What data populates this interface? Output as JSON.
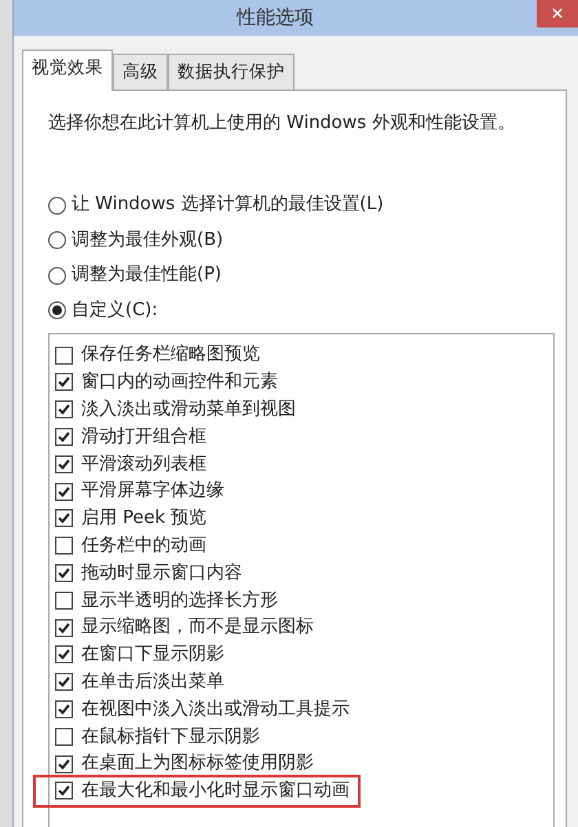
{
  "window": {
    "title": "性能选项",
    "close": "✕"
  },
  "tabs": [
    {
      "label": "视觉效果",
      "selected": true
    },
    {
      "label": "高级",
      "selected": false
    },
    {
      "label": "数据执行保护",
      "selected": false
    }
  ],
  "intro": "选择你想在此计算机上使用的 Windows 外观和性能设置。",
  "options": [
    {
      "label": "让 Windows 选择计算机的最佳设置(L)",
      "selected": false
    },
    {
      "label": "调整为最佳外观(B)",
      "selected": false
    },
    {
      "label": "调整为最佳性能(P)",
      "selected": false
    },
    {
      "label": "自定义(C):",
      "selected": true
    }
  ],
  "effects": [
    {
      "label": "保存任务栏缩略图预览",
      "checked": false,
      "highlighted": false
    },
    {
      "label": "窗口内的动画控件和元素",
      "checked": true,
      "highlighted": false
    },
    {
      "label": "淡入淡出或滑动菜单到视图",
      "checked": true,
      "highlighted": false
    },
    {
      "label": "滑动打开组合框",
      "checked": true,
      "highlighted": false
    },
    {
      "label": "平滑滚动列表框",
      "checked": true,
      "highlighted": false
    },
    {
      "label": "平滑屏幕字体边缘",
      "checked": true,
      "highlighted": false
    },
    {
      "label": "启用 Peek 预览",
      "checked": true,
      "highlighted": false
    },
    {
      "label": "任务栏中的动画",
      "checked": false,
      "highlighted": false
    },
    {
      "label": "拖动时显示窗口内容",
      "checked": true,
      "highlighted": false
    },
    {
      "label": "显示半透明的选择长方形",
      "checked": false,
      "highlighted": false
    },
    {
      "label": "显示缩略图，而不是显示图标",
      "checked": true,
      "highlighted": false
    },
    {
      "label": "在窗口下显示阴影",
      "checked": true,
      "highlighted": false
    },
    {
      "label": "在单击后淡出菜单",
      "checked": true,
      "highlighted": false
    },
    {
      "label": "在视图中淡入淡出或滑动工具提示",
      "checked": true,
      "highlighted": false
    },
    {
      "label": "在鼠标指针下显示阴影",
      "checked": false,
      "highlighted": false
    },
    {
      "label": "在桌面上为图标标签使用阴影",
      "checked": true,
      "highlighted": false
    },
    {
      "label": "在最大化和最小化时显示窗口动画",
      "checked": true,
      "highlighted": true
    }
  ]
}
